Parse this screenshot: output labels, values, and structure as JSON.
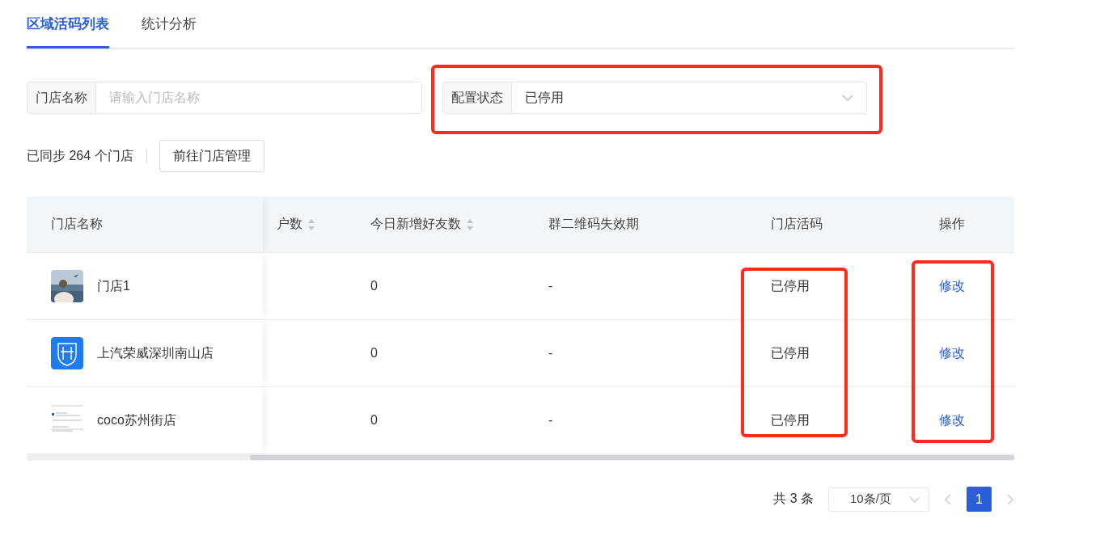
{
  "tabs": [
    {
      "label": "区域活码列表",
      "selected": true
    },
    {
      "label": "统计分析",
      "selected": false
    }
  ],
  "filters": {
    "store_name": {
      "label": "门店名称",
      "placeholder": "请输入门店名称"
    },
    "config_status": {
      "label": "配置状态",
      "value": "已停用"
    }
  },
  "sync_info": "已同步 264 个门店",
  "manage_button": "前往门店管理",
  "table": {
    "columns": [
      {
        "label": "门店名称",
        "sortable": false
      },
      {
        "label": "户数",
        "sortable": true
      },
      {
        "label": "今日新增好友数",
        "sortable": true
      },
      {
        "label": "群二维码失效期",
        "sortable": false
      },
      {
        "label": "门店活码",
        "sortable": false
      },
      {
        "label": "操作",
        "sortable": false
      }
    ],
    "rows": [
      {
        "kind": "picture",
        "name": "门店1",
        "new_friends": "0",
        "qr_expiry": "-",
        "status": "已停用",
        "action": "修改"
      },
      {
        "kind": "logo",
        "name": "上汽荣威深圳南山店",
        "new_friends": "0",
        "qr_expiry": "-",
        "status": "已停用",
        "action": "修改"
      },
      {
        "kind": "document",
        "name": "coco苏州街店",
        "new_friends": "0",
        "qr_expiry": "-",
        "status": "已停用",
        "action": "修改"
      }
    ]
  },
  "pagination": {
    "total": "共 3 条",
    "page_size": "10条/页",
    "pages": [
      {
        "label": "1",
        "selected": true
      }
    ]
  }
}
